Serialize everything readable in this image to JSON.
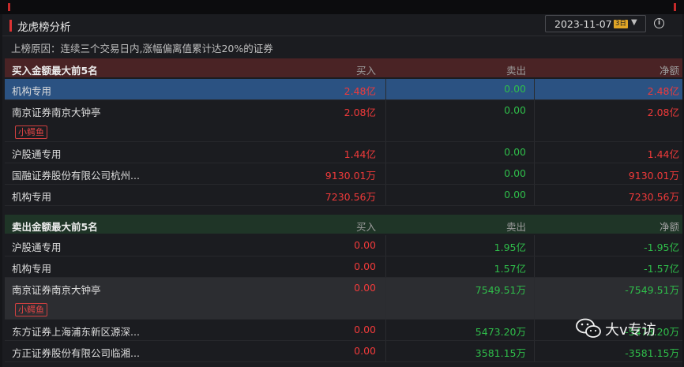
{
  "header": {
    "title": "龙虎榜分析",
    "date": "2023-11-07",
    "date_badge": "3日",
    "info_icon": "info-icon"
  },
  "reason": "上榜原因：连续三个交易日内,涨幅偏离值累计达20%的证券",
  "buy_section": {
    "title": "买入金额最大前5名",
    "col_buy": "买入",
    "col_sell": "卖出",
    "col_net": "净额",
    "rows": [
      {
        "name": "机构专用",
        "buy": "2.48亿",
        "sell": "0.00",
        "net": "2.48亿"
      },
      {
        "name": "南京证券南京大钟亭",
        "tag": "小鳄鱼",
        "buy": "2.08亿",
        "sell": "0.00",
        "net": "2.08亿"
      },
      {
        "name": "沪股通专用",
        "buy": "1.44亿",
        "sell": "0.00",
        "net": "1.44亿"
      },
      {
        "name": "国融证券股份有限公司杭州...",
        "buy": "9130.01万",
        "sell": "0.00",
        "net": "9130.01万"
      },
      {
        "name": "机构专用",
        "buy": "7230.56万",
        "sell": "0.00",
        "net": "7230.56万"
      }
    ]
  },
  "sell_section": {
    "title": "卖出金额最大前5名",
    "col_buy": "买入",
    "col_sell": "卖出",
    "col_net": "净额",
    "rows": [
      {
        "name": "沪股通专用",
        "buy": "0.00",
        "sell": "1.95亿",
        "net": "-1.95亿"
      },
      {
        "name": "机构专用",
        "buy": "0.00",
        "sell": "1.57亿",
        "net": "-1.57亿"
      },
      {
        "name": "南京证券南京大钟亭",
        "tag": "小鳄鱼",
        "buy": "0.00",
        "sell": "7549.51万",
        "net": "-7549.51万"
      },
      {
        "name": "东方证券上海浦东新区源深...",
        "buy": "0.00",
        "sell": "5473.20万",
        "net": "-5473.20万"
      },
      {
        "name": "方正证券股份有限公司临湘...",
        "buy": "0.00",
        "sell": "3581.15万",
        "net": "-3581.15万"
      }
    ]
  },
  "watermark": {
    "icon": "wechat-icon",
    "text": "大v专访"
  },
  "colors": {
    "up": "#f03a3a",
    "down": "#2fbd4a",
    "buy_header_bg": "#4a2325",
    "sell_header_bg": "#1f3527",
    "selected_row_bg": "#2b5282"
  }
}
